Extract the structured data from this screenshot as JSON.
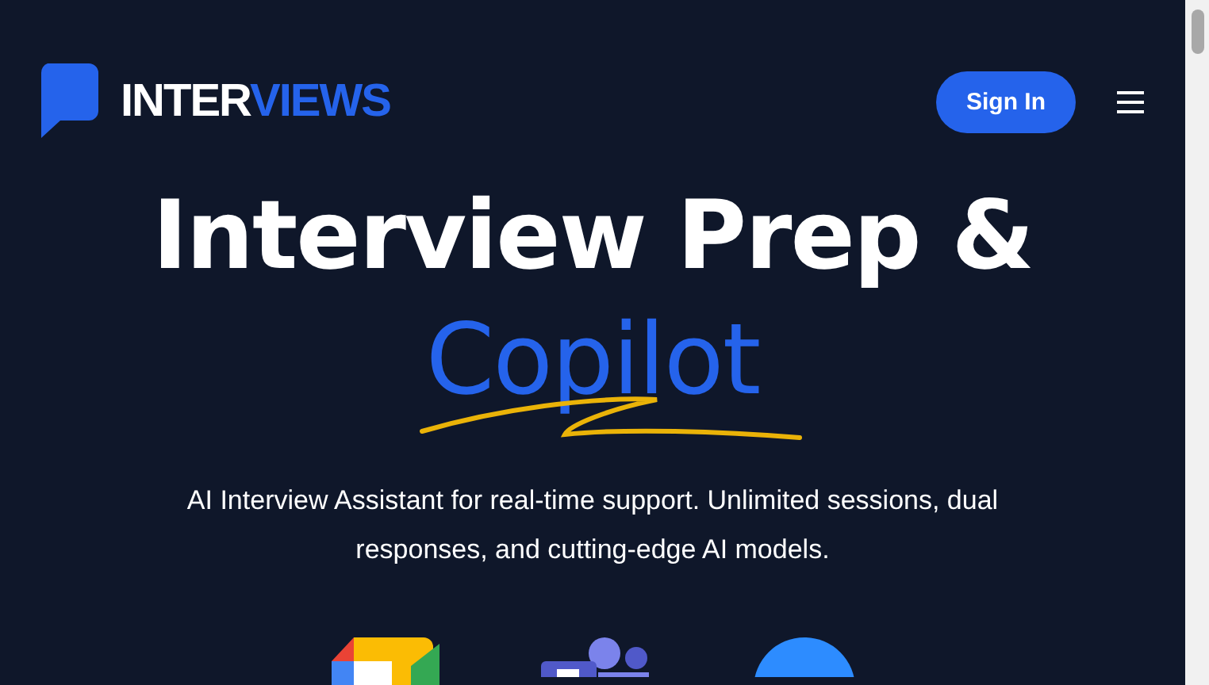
{
  "header": {
    "logo": {
      "part_1": "INTER",
      "part_2": "VIEWS"
    },
    "sign_in_button": "Sign In"
  },
  "hero": {
    "title_line_1": "Interview Prep &",
    "title_line_2": "Copilot",
    "description": "AI Interview Assistant for real-time support. Unlimited sessions, dual responses, and cutting-edge AI models."
  }
}
